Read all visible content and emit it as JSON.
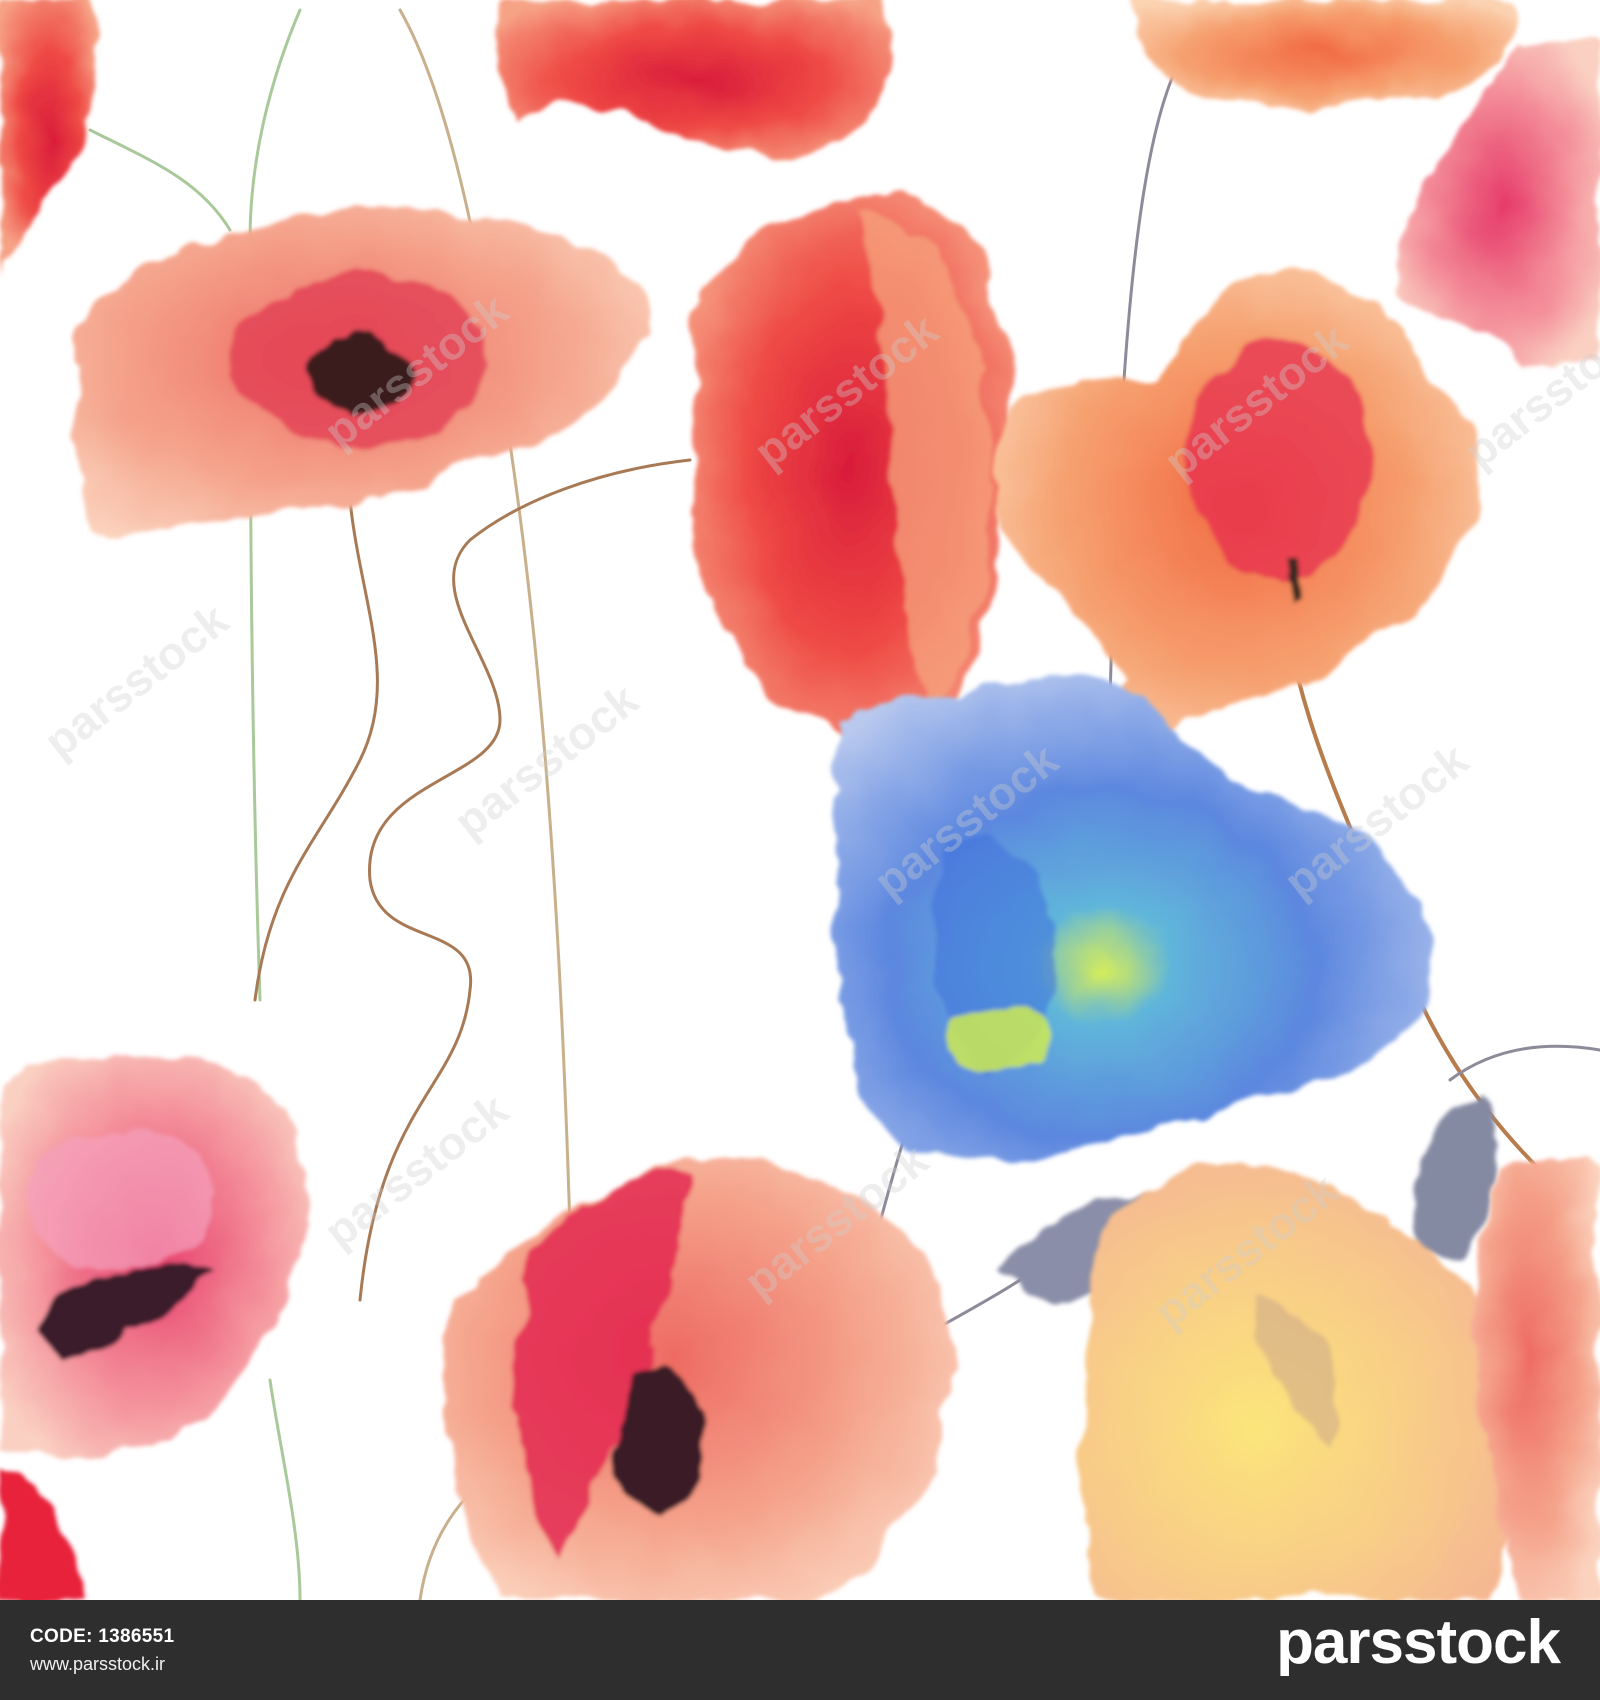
{
  "image": {
    "subject": "watercolor floral pattern with red poppies and a blue flower",
    "palette": {
      "poppy_red": "#e8333a",
      "poppy_pink": "#f2868a",
      "peach": "#f6b08c",
      "blue_petal": "#6e9de0",
      "green_center": "#c9e86a",
      "yellow_petal": "#f8e27a",
      "stem_brown": "#a77a55",
      "stem_green": "#a9c99a",
      "bud_gray": "#8a8ea8"
    },
    "watermark": "parsstock"
  },
  "footer": {
    "code": "CODE: 1386551",
    "site": "www.parsstock.ir",
    "logo": "parsstock",
    "background": "#2e2e2e"
  }
}
